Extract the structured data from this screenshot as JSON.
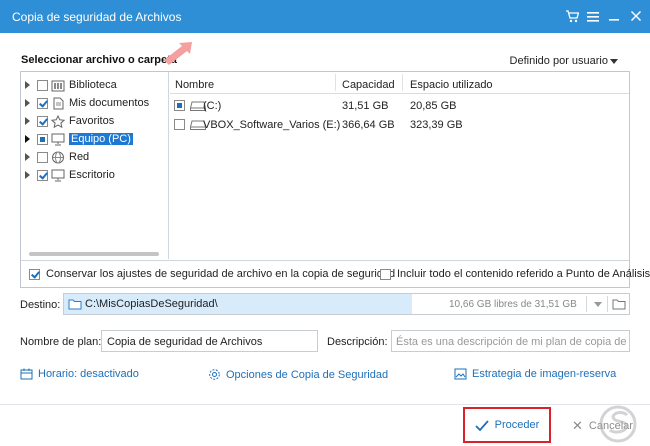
{
  "window": {
    "title": "Copia de seguridad de Archivos",
    "controls": [
      "cart-icon",
      "menu-icon",
      "minimize-icon",
      "close-icon"
    ],
    "titlebar_color": "#2f8fd6"
  },
  "selection": {
    "heading": "Seleccionar archivo o carpeta",
    "mode_dropdown": "Definido por usuario"
  },
  "tree": {
    "items": [
      {
        "label": "Biblioteca",
        "checked": false,
        "icon": "library-icon"
      },
      {
        "label": "Mis documentos",
        "checked": true,
        "icon": "documents-icon"
      },
      {
        "label": "Favoritos",
        "checked": true,
        "icon": "star-icon"
      },
      {
        "label": "Equipo (PC)",
        "checked": "partial",
        "icon": "computer-icon",
        "selected": true
      },
      {
        "label": "Red",
        "checked": false,
        "icon": "network-icon"
      },
      {
        "label": "Escritorio",
        "checked": true,
        "icon": "desktop-icon"
      }
    ]
  },
  "list": {
    "columns": [
      "Nombre",
      "Capacidad",
      "Espacio utilizado"
    ],
    "rows": [
      {
        "name": "(C:)",
        "capacity": "31,51 GB",
        "used": "20,85 GB",
        "checked": "partial"
      },
      {
        "name": "VBOX_Software_Varios (E:)",
        "capacity": "366,64 GB",
        "used": "323,39 GB",
        "checked": false
      }
    ]
  },
  "options": {
    "keep_security": "Conservar los ajustes de seguridad de archivo en la copia de seguridad",
    "include_junction": "Incluir todo el contenido referido a Punto de Análisis"
  },
  "destination": {
    "label": "Destino:",
    "path": "C:\\MisCopiasDeSeguridad\\",
    "free": "10,66 GB libres de 31,51 GB"
  },
  "plan": {
    "name_label": "Nombre de plan:",
    "name_value": "Copia de seguridad de Archivos",
    "desc_label": "Descripción:",
    "desc_placeholder": "Ésta es una descripción de mi plan de copia de segu"
  },
  "links": {
    "schedule": "Horario: desactivado",
    "options": "Opciones de Copia de Seguridad",
    "strategy": "Estrategia de imagen-reserva"
  },
  "actions": {
    "proceed": "Proceder",
    "cancel": "Cancelar"
  },
  "colors": {
    "accent": "#1f6fb8",
    "highlight_border": "#d9222a",
    "arrow": "#f4a0a0"
  }
}
